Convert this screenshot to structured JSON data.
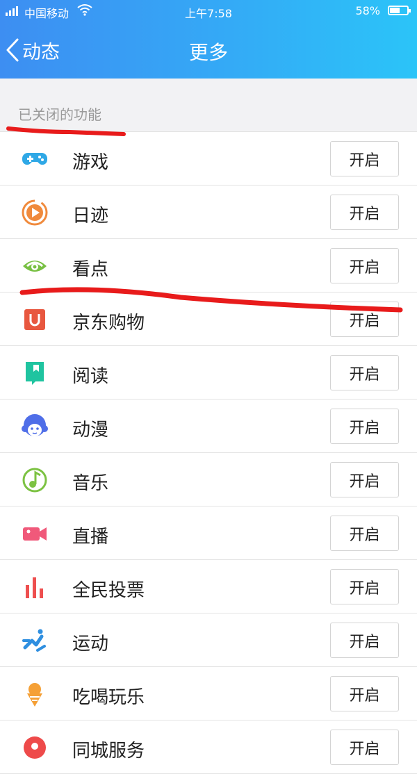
{
  "status_bar": {
    "carrier": "中国移动",
    "time": "上午7:58",
    "battery": "58%",
    "battery_level": 0.58
  },
  "nav": {
    "back_label": "动态",
    "title": "更多"
  },
  "section": {
    "label": "已关闭的功能"
  },
  "items": [
    {
      "label": "游戏",
      "button": "开启",
      "icon": "gamepad-icon",
      "color": "#2fa8e6"
    },
    {
      "label": "日迹",
      "button": "开启",
      "icon": "play-circle-icon",
      "color": "#f08a3c"
    },
    {
      "label": "看点",
      "button": "开启",
      "icon": "eye-icon",
      "color": "#78c043"
    },
    {
      "label": "京东购物",
      "button": "开启",
      "icon": "shopping-bag-icon",
      "color": "#e8573f"
    },
    {
      "label": "阅读",
      "button": "开启",
      "icon": "book-icon",
      "color": "#1fc4a0"
    },
    {
      "label": "动漫",
      "button": "开启",
      "icon": "cartoon-face-icon",
      "color": "#4f6ee8"
    },
    {
      "label": "音乐",
      "button": "开启",
      "icon": "music-note-icon",
      "color": "#7cc242"
    },
    {
      "label": "直播",
      "button": "开启",
      "icon": "video-camera-icon",
      "color": "#f0597a"
    },
    {
      "label": "全民投票",
      "button": "开启",
      "icon": "bar-chart-icon",
      "color": "#ee4f4f"
    },
    {
      "label": "运动",
      "button": "开启",
      "icon": "running-icon",
      "color": "#2f8fe0"
    },
    {
      "label": "吃喝玩乐",
      "button": "开启",
      "icon": "ice-cream-icon",
      "color": "#f5a036"
    },
    {
      "label": "同城服务",
      "button": "开启",
      "icon": "location-icon",
      "color": "#ee4a4a"
    }
  ],
  "colors": {
    "accent_gradient_start": "#3d8ef2",
    "accent_gradient_end": "#2bc4f8",
    "annotation_red": "#e81b1b"
  }
}
